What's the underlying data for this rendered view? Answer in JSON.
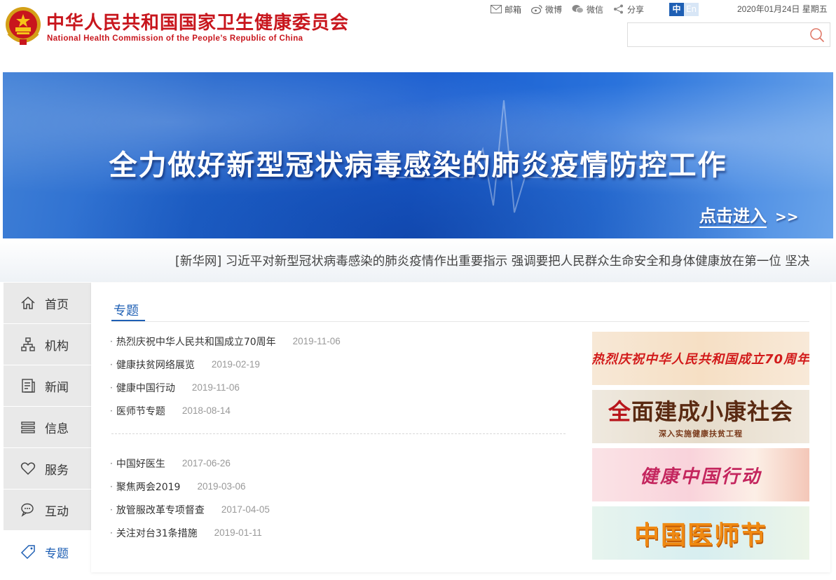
{
  "header": {
    "title": "中华人民共和国国家卫生健康委员会",
    "subtitle": "National Health Commission of the People’s Republic of China",
    "links": [
      {
        "label": "邮箱",
        "icon": "mail-icon"
      },
      {
        "label": "微博",
        "icon": "weibo-icon"
      },
      {
        "label": "微信",
        "icon": "wechat-icon"
      },
      {
        "label": "分享",
        "icon": "share-icon"
      }
    ],
    "lang_zh": "中",
    "lang_en": "En",
    "date": "2020年01月24日 星期五",
    "search_placeholder": ""
  },
  "banner": {
    "title": "全力做好新型冠状病毒感染的肺炎疫情防控工作",
    "enter_label": "点击进入",
    "enter_arrow": ">>"
  },
  "ticker": {
    "text": "[新华网] 习近平对新型冠状病毒感染的肺炎疫情作出重要指示 强调要把人民群众生命安全和身体健康放在第一位 坚决"
  },
  "sidebar": {
    "items": [
      {
        "label": "首页",
        "icon": "home-icon"
      },
      {
        "label": "机构",
        "icon": "org-chart-icon"
      },
      {
        "label": "新闻",
        "icon": "news-icon"
      },
      {
        "label": "信息",
        "icon": "info-stack-icon"
      },
      {
        "label": "服务",
        "icon": "heart-icon"
      },
      {
        "label": "互动",
        "icon": "chat-icon"
      },
      {
        "label": "专题",
        "icon": "tag-icon",
        "active": true
      }
    ]
  },
  "main": {
    "section_title": "专题",
    "list_one": [
      {
        "title": "热烈庆祝中华人民共和国成立70周年",
        "date": "2019-11-06"
      },
      {
        "title": "健康扶贫网络展览",
        "date": "2019-02-19"
      },
      {
        "title": "健康中国行动",
        "date": "2019-11-06"
      },
      {
        "title": "医师节专题",
        "date": "2018-08-14"
      }
    ],
    "list_two": [
      {
        "title": "中国好医生",
        "date": "2017-06-26"
      },
      {
        "title": "聚焦两会2019",
        "date": "2019-03-06"
      },
      {
        "title": "放管服改革专项督查",
        "date": "2017-04-05"
      },
      {
        "title": "关注对台31条措施",
        "date": "2019-01-11"
      }
    ],
    "promos": {
      "p1": "热烈庆祝中华人民共和国成立70周年",
      "p2_red": "全",
      "p2_main": "面建成小康社会",
      "p2_small": "深入实施健康扶贫工程",
      "p3": "健康中国行动",
      "p4": "中国医师节"
    }
  },
  "colors": {
    "brand_red": "#c8161d",
    "accent_blue": "#1e5fb4",
    "sidebar_bg": "#e9e9e9"
  }
}
